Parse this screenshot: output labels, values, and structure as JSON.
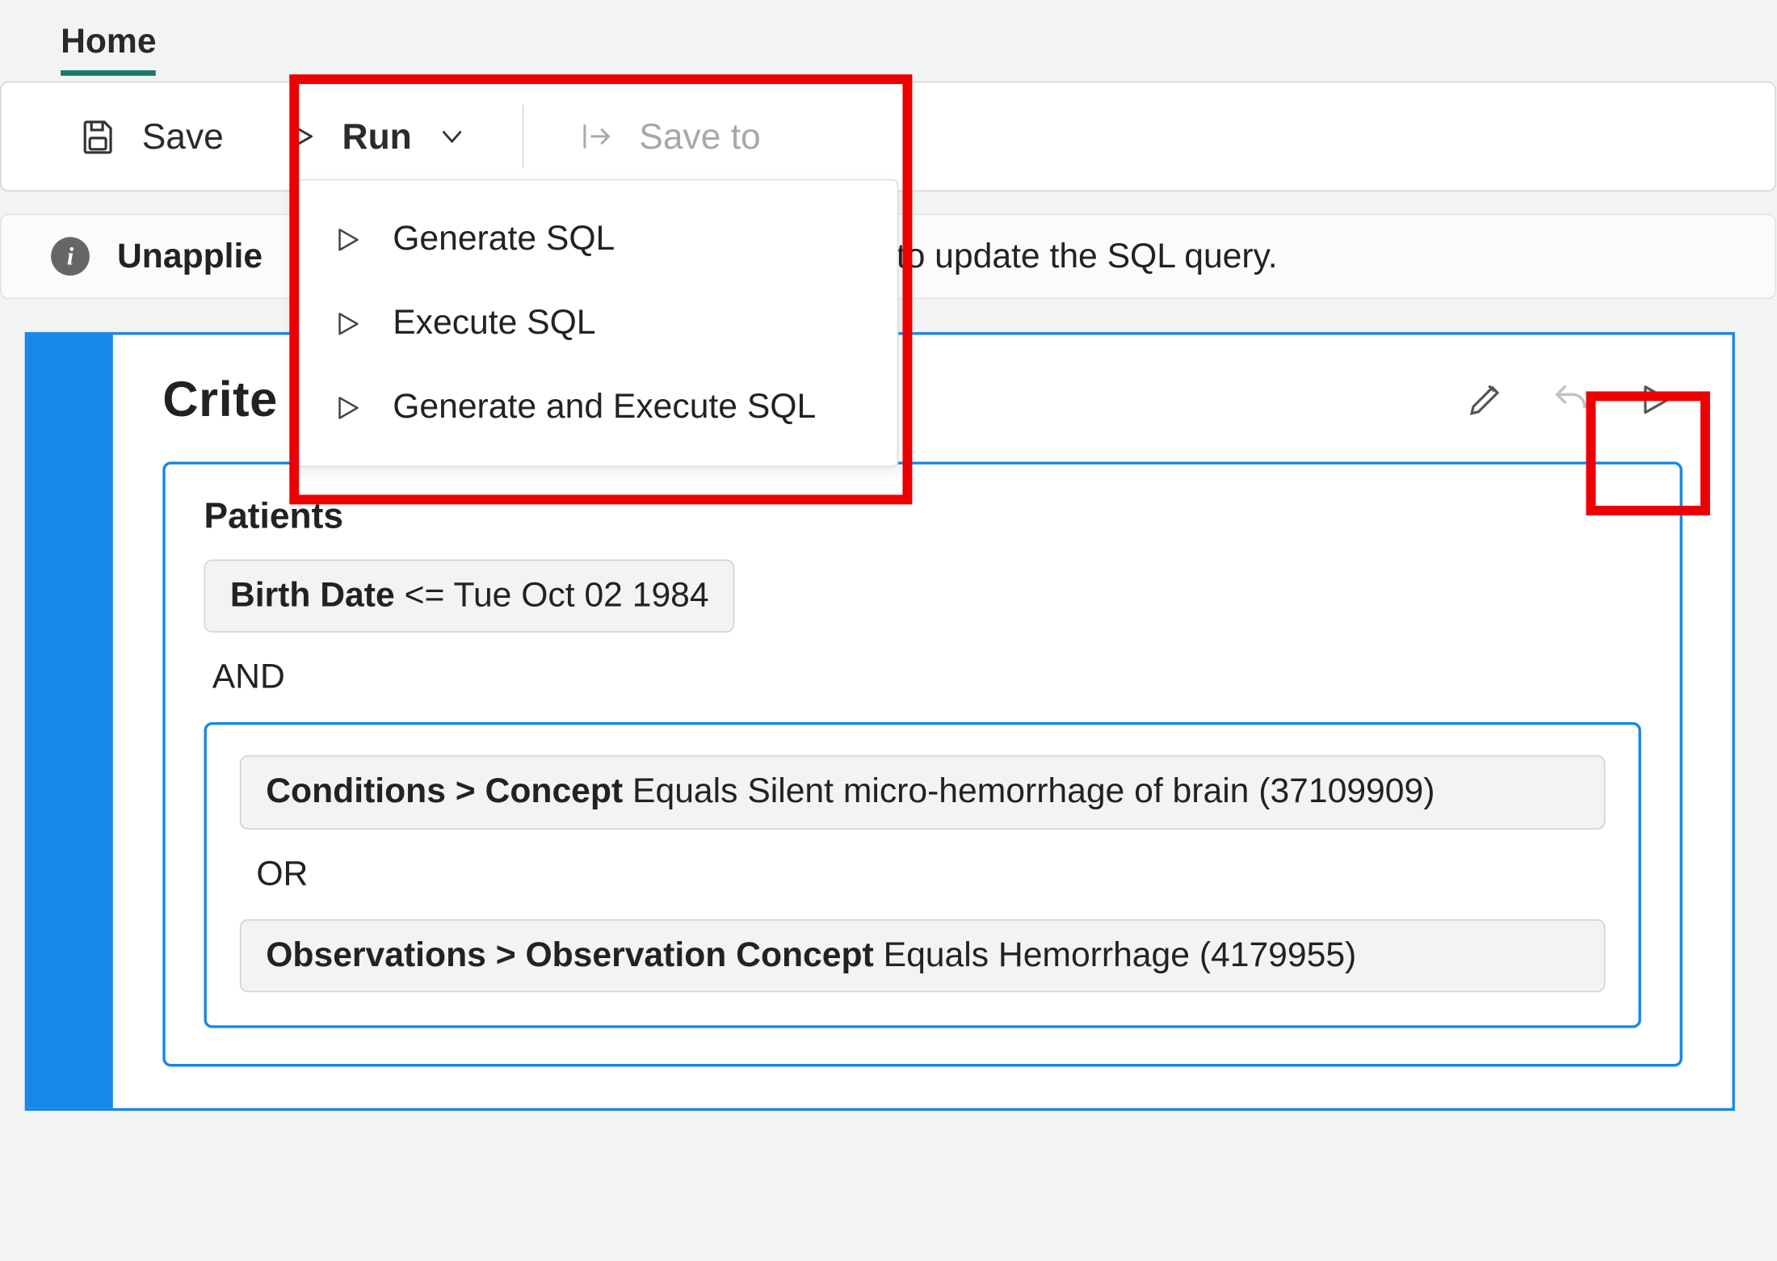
{
  "tabs": {
    "home": "Home"
  },
  "toolbar": {
    "save_label": "Save",
    "run_label": "Run",
    "save_to_label": "Save to"
  },
  "run_menu": {
    "generate_label": "Generate SQL",
    "execute_label": "Execute SQL",
    "generate_execute_label": "Generate and Execute SQL"
  },
  "info_bar": {
    "prefix_visible": "Unapplie",
    "suffix_visible": "L to update the SQL query."
  },
  "criteria": {
    "title_visible": "Crite",
    "patients_label": "Patients",
    "birth_filter": {
      "field": "Birth Date",
      "operator": "<=",
      "value": "Tue Oct 02 1984"
    },
    "logic_and": "AND",
    "group": {
      "cond1": {
        "path": "Conditions > Concept",
        "op": "Equals",
        "value": "Silent micro-hemorrhage of brain (37109909)"
      },
      "logic_or": "OR",
      "cond2": {
        "path": "Observations > Observation Concept",
        "op": "Equals",
        "value": "Hemorrhage (4179955)"
      }
    }
  }
}
